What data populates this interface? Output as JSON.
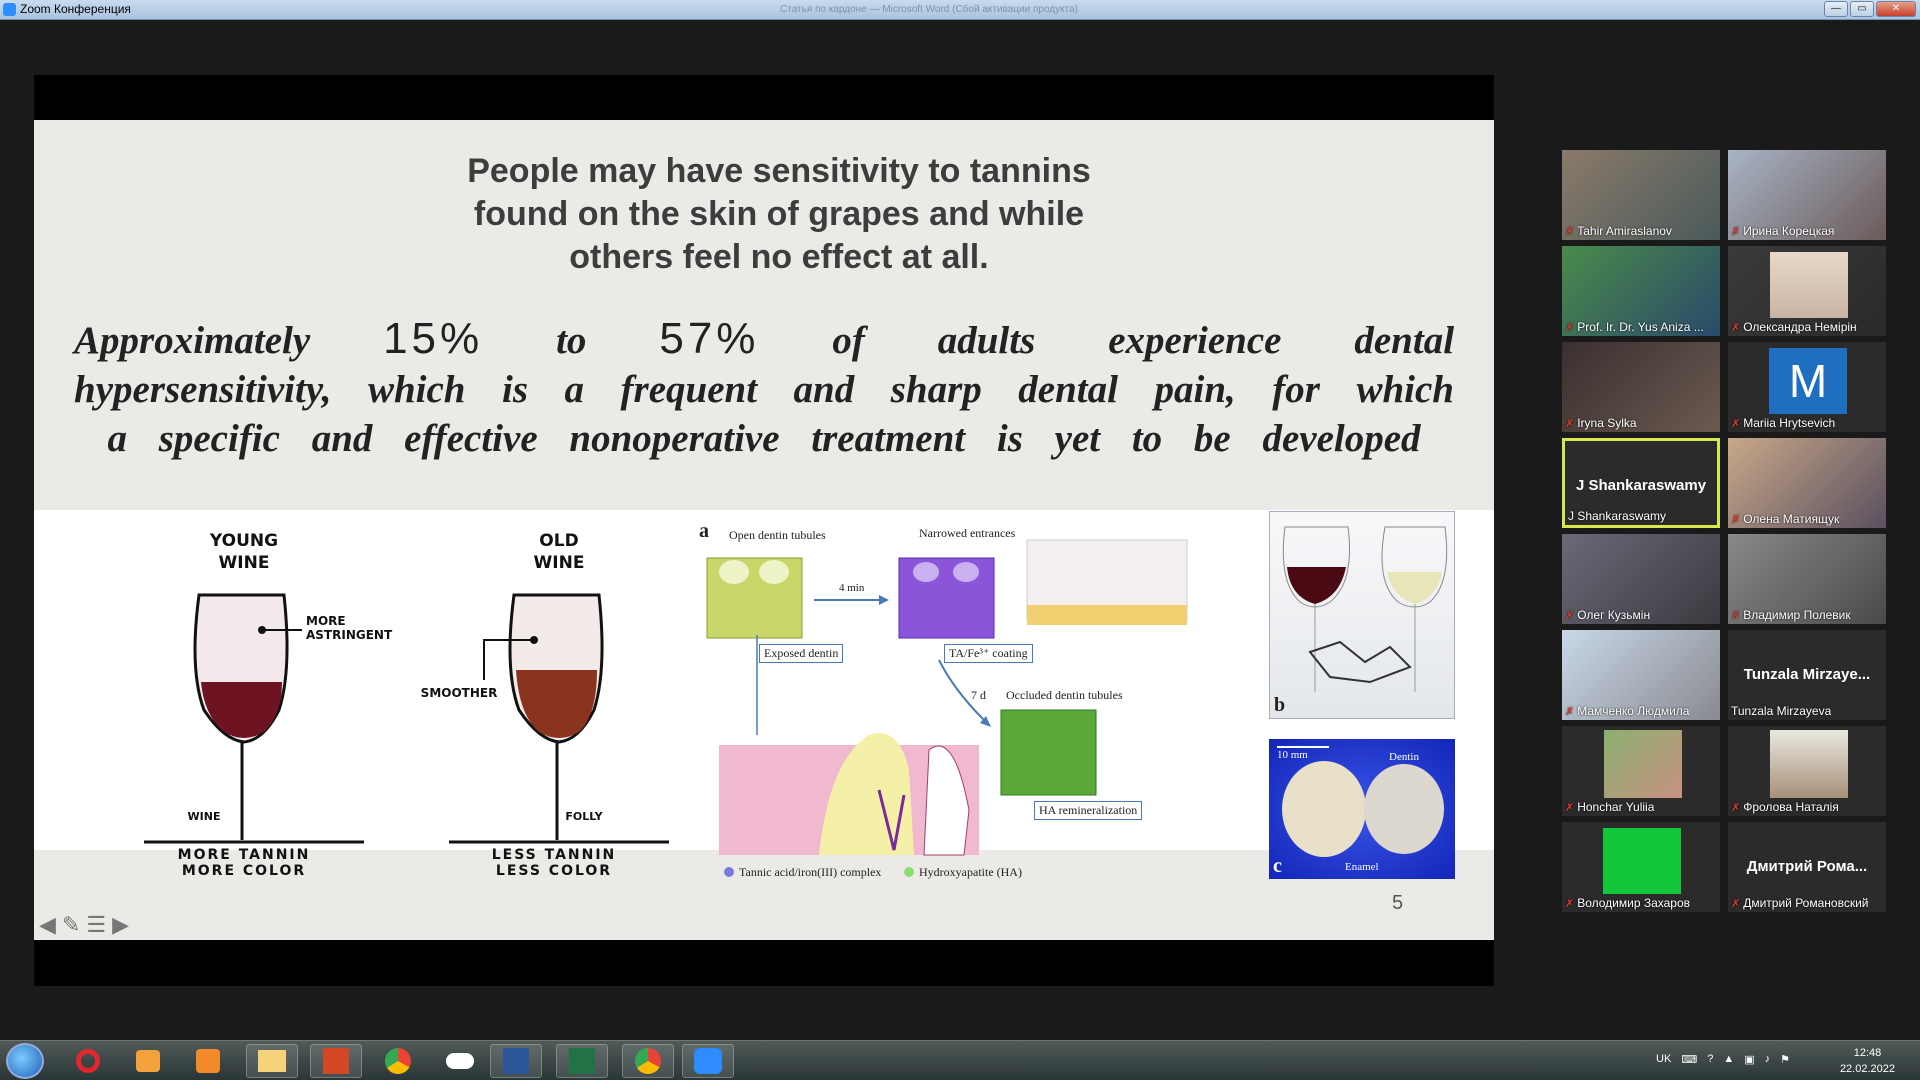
{
  "window": {
    "title": "Zoom Конференция",
    "faded_title": "Статья по кардоне — Microsoft Word (Сбой активации продукта)",
    "minimize": "—",
    "maximize": "▭",
    "close": "✕"
  },
  "slide": {
    "heading_lines": [
      "People may have sensitivity to tannins",
      "found on the skin of grapes and while",
      "others feel no effect at all."
    ],
    "body": {
      "pre": "Approximately",
      "pct1": "15%",
      "to": "to",
      "pct2": "57%",
      "post": "of adults experience dental hypersensitivity, which is a frequent and sharp dental pain, for which a specific and effective nonoperative treatment is yet to be developed"
    },
    "wine": {
      "young_title": "YOUNG WINE",
      "old_title": "OLD WINE",
      "more_astringent": "MORE ASTRINGENT",
      "smoother": "SMOOTHER",
      "wine_label": "WINE",
      "folly_label": "FOLLY",
      "young_caption": "MORE TANNIN MORE COLOR",
      "old_caption": "LESS TANNIN LESS COLOR"
    },
    "diagram": {
      "panel_a": "a",
      "open_tubules": "Open dentin tubules",
      "narrowed": "Narrowed entrances",
      "time_4min": "4 min",
      "exposed": "Exposed dentin",
      "coating": "TA/Fe³⁺ coating",
      "time_7d": "7 d",
      "occluded": "Occluded dentin tubules",
      "ha_remin": "HA remineralization",
      "legend1": "Tannic acid/iron(III) complex",
      "legend2": "Hydroxyapatite (HA)",
      "panel_b": "b",
      "panel_c": "c",
      "scale": "10 mm",
      "dentin": "Dentin",
      "enamel": "Enamel"
    },
    "page_number": "5",
    "nav": {
      "prev": "◀",
      "pen": "✎",
      "menu": "☰",
      "next": "▶"
    }
  },
  "gallery": [
    {
      "name": "Tahir Amiraslanov",
      "muted": true
    },
    {
      "name": "Ирина Корецкая",
      "muted": true
    },
    {
      "name": "Prof. Ir. Dr. Yus Aniza ...",
      "muted": true
    },
    {
      "name": "Олександра Немірін",
      "muted": true
    },
    {
      "name": "Iryna Sylka",
      "muted": true
    },
    {
      "name": "Mariia Hrytsevich",
      "muted": true,
      "avatar": "M"
    },
    {
      "name": "J Shankaraswamy",
      "muted": false,
      "center": "J Shankaraswamy",
      "active": true
    },
    {
      "name": "Олена Матиящук",
      "muted": true
    },
    {
      "name": "Олег Кузьмін",
      "muted": true
    },
    {
      "name": "Владимир Полевик",
      "muted": true
    },
    {
      "name": "Мамченко Людмила",
      "muted": true
    },
    {
      "name": "Tunzala Mirzayeva",
      "muted": false,
      "center": "Tunzala Mirzaye..."
    },
    {
      "name": "Honchar Yuliia",
      "muted": true
    },
    {
      "name": "Фролова Наталія",
      "muted": true
    },
    {
      "name": "Володимир Захаров",
      "muted": true,
      "green": true
    },
    {
      "name": "Дмитрий Романовский",
      "muted": true,
      "center": "Дмитрий Рома..."
    }
  ],
  "taskbar": {
    "apps": [
      "opera-icon",
      "media-player-icon",
      "paint-icon",
      "file-explorer-icon",
      "powerpoint-icon",
      "chrome-icon",
      "onedrive-icon",
      "word-icon",
      "excel-icon",
      "chrome-icon",
      "zoom-icon"
    ],
    "lang": "UK",
    "time": "12:48",
    "date": "22.02.2022"
  }
}
